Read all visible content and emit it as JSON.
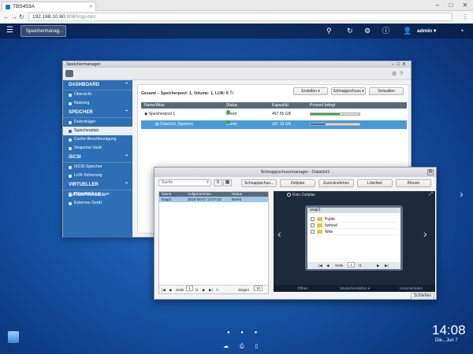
{
  "browser": {
    "tab_title": "TBS453A",
    "tab_close": "×",
    "controls": {
      "minimize": "–",
      "maximize": "□",
      "close": "✕"
    },
    "nav": {
      "back": "←",
      "forward": "→",
      "reload": "↻"
    },
    "url_host": "192.168.10.60",
    "url_path": ":8080/cgi-bin/",
    "menu": "⋮"
  },
  "qts": {
    "menu_icon": "☰",
    "app_tab_label": "Speichermanag...",
    "user": "admin ▾",
    "icons": {
      "search": "⚲",
      "refresh": "↻",
      "network": "⚙",
      "info": "ⓘ",
      "user": "👤",
      "dashboard": "◔"
    },
    "desktop_next": "›"
  },
  "storage_manager": {
    "title": "Speichermanager",
    "window_controls": "–□✕",
    "toolbar_right": "⚙?",
    "sidebar": {
      "sections": [
        {
          "title": "DASHBOARD",
          "items": [
            "Übersicht",
            "Nutzung"
          ]
        },
        {
          "title": "SPEICHER",
          "items": [
            "Datenträger",
            "Speicherplatz",
            "Cache-Beschleunigung",
            "Snapshot Vault"
          ]
        },
        {
          "title": "iSCSI",
          "items": [
            "iSCSI-Speicher",
            "LUN-Sicherung"
          ]
        },
        {
          "title": "VIRTUELLER DATENTRÄGE...",
          "items": [
            "Remotedatenträger",
            "Externes Gerät"
          ]
        }
      ],
      "active_item": "Speicherplatz",
      "caret": "⌃"
    },
    "summary": "Gesamt – Speicherpool: 1, Volume: 1, LUN: 0",
    "buttons": {
      "create": "Erstellen ▾",
      "snapshot": "Schnappschuss ▾",
      "manage": "Verwalten"
    },
    "table": {
      "headers": [
        "Name/Alias",
        "Status",
        "Kapazität",
        "Prozent belegt"
      ],
      "rows": [
        {
          "name": "Speicherpool 1",
          "status": "Bereit",
          "capacity": "457.55 GB",
          "percent": 60,
          "bar_color": "#3aa63a"
        },
        {
          "name": "DataVol1 (System)",
          "status": "Bereit",
          "capacity": "167.19 GB",
          "percent": 30,
          "bar_color": "#2d6fb5"
        }
      ]
    }
  },
  "snapshot_manager": {
    "title": "Schnappschussmanager - DataVol1",
    "search_placeholder": "Suche",
    "buttons": [
      "Schnappschus...",
      "Zeitplan",
      "Zurücknehmen",
      "Löschen",
      "Klonen"
    ],
    "table": {
      "headers": [
        "Name",
        "Aufgenommen",
        "Status"
      ],
      "rows": [
        {
          "name": "snap1",
          "taken": "2016-06-07 14:07:03",
          "status": "Bereit"
        }
      ]
    },
    "pager": {
      "page_label": "Seite",
      "page": "1",
      "of": "/1",
      "show_label": "Zeigen",
      "per_page": "10"
    },
    "preview": {
      "schedule": "Kein Zeitplan",
      "snapshot_name": "snap1",
      "folders": [
        "Public",
        "hwheel",
        "Web"
      ],
      "page_label": "Seite",
      "page": "1",
      "of": "/1"
    },
    "actions": [
      "Öffnen",
      "Wiederherstellen ▾",
      "Herunterladen"
    ],
    "close": "Schließen"
  },
  "desktop": {
    "time": "14:08",
    "date": "Die., Jun 7",
    "dots": "● ● ●",
    "bottom_icons": "☁ ⎙ ▯"
  }
}
